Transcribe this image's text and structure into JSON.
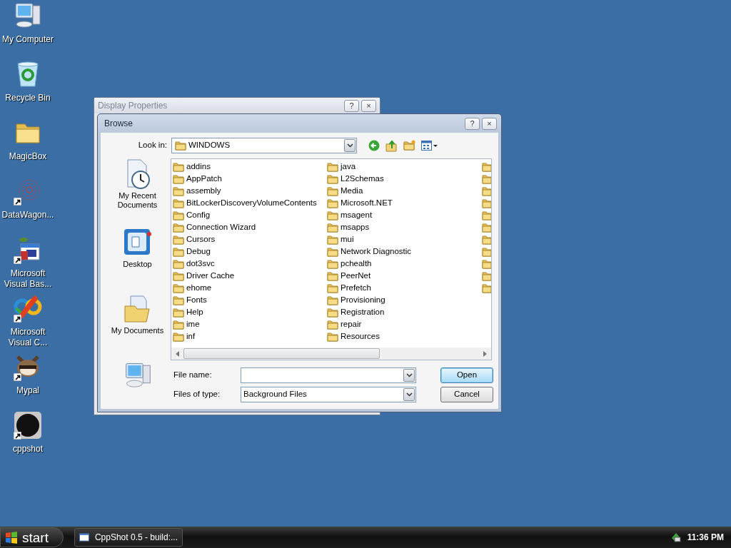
{
  "desktop": {
    "icons": [
      {
        "label": "My Computer",
        "kind": "computer",
        "shortcut": false
      },
      {
        "label": "Recycle Bin",
        "kind": "recycle",
        "shortcut": false
      },
      {
        "label": "MagicBox",
        "kind": "folder",
        "shortcut": false
      },
      {
        "label": "DataWagon...",
        "kind": "spiral",
        "shortcut": true
      },
      {
        "label": "Microsoft Visual Bas...",
        "kind": "calendar",
        "shortcut": true
      },
      {
        "label": "Microsoft Visual C...",
        "kind": "infinity",
        "shortcut": true
      },
      {
        "label": "Mypal",
        "kind": "raccoon",
        "shortcut": true
      },
      {
        "label": "cppshot",
        "kind": "disc",
        "shortcut": true
      }
    ]
  },
  "background_window": {
    "title": "Display Properties",
    "active": false,
    "title_buttons": [
      "?",
      "×"
    ]
  },
  "dialog": {
    "title": "Browse",
    "active": true,
    "title_buttons": [
      "?",
      "×"
    ],
    "look_in": {
      "label": "Look in:",
      "value": "WINDOWS"
    },
    "places": [
      {
        "label": "My Recent Documents",
        "kind": "recent"
      },
      {
        "label": "Desktop",
        "kind": "desktop"
      },
      {
        "label": "My Documents",
        "kind": "documents"
      },
      {
        "kind": "computer"
      }
    ],
    "file_list": {
      "column_1": [
        "addins",
        "AppPatch",
        "assembly",
        "BitLockerDiscoveryVolumeContents",
        "Config",
        "Connection Wizard",
        "Cursors",
        "Debug",
        "dot3svc",
        "Driver Cache",
        "ehome",
        "Fonts",
        "Help",
        "ime",
        "inf"
      ],
      "column_2": [
        "java",
        "L2Schemas",
        "Media",
        "Microsoft.NET",
        "msagent",
        "msapps",
        "mui",
        "Network Diagnostic",
        "pchealth",
        "PeerNet",
        "Prefetch",
        "Provisioning",
        "Registration",
        "repair",
        "Resources"
      ],
      "column_3": [
        {
          "kind": "folder"
        },
        {
          "kind": "folder"
        },
        {
          "kind": "folder"
        },
        {
          "kind": "folder"
        },
        {
          "kind": "folder"
        },
        {
          "kind": "folder"
        },
        {
          "kind": "folder"
        },
        {
          "kind": "folder"
        },
        {
          "kind": "folder"
        },
        {
          "kind": "folder"
        },
        {
          "kind": "folder"
        }
      ]
    },
    "file_name": {
      "label": "File name:"
    },
    "files_of_type": {
      "label": "Files of type:",
      "value": "Background Files"
    },
    "buttons": [
      {
        "label": "Open",
        "default": true
      },
      {
        "label": "Cancel",
        "default": false
      }
    ]
  },
  "taskbar": {
    "start": "start",
    "tasks": [
      {
        "label": "CppShot 0.5 - build:..."
      }
    ],
    "clock": "11:36 PM"
  }
}
